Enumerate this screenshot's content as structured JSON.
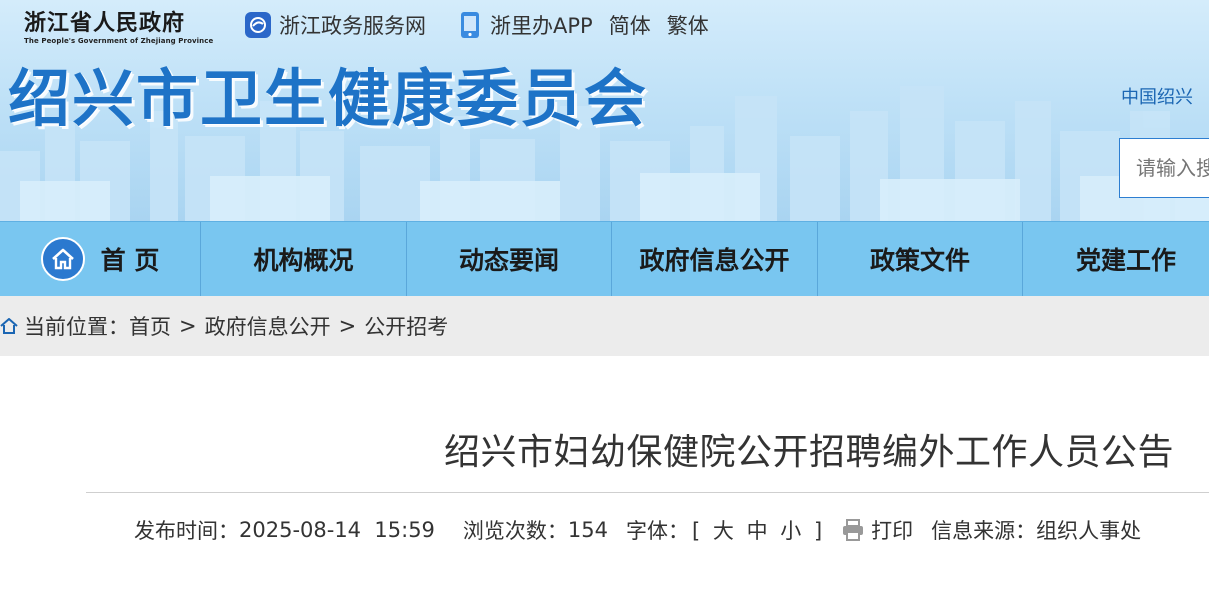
{
  "header": {
    "province_logo": {
      "zh": "浙江省人民政府",
      "en": "The People's Government of Zhejiang Province"
    },
    "links": {
      "gov_service": "浙江政务服务网",
      "app": "浙里办APP",
      "simplified": "简体",
      "traditional": "繁体"
    },
    "site_title": "绍兴市卫生健康委员会",
    "region_label": "中国绍兴",
    "search_placeholder": "请输入搜索内容"
  },
  "nav": {
    "items": [
      {
        "label": "首 页",
        "icon": "home-icon"
      },
      {
        "label": "机构概况"
      },
      {
        "label": "动态要闻"
      },
      {
        "label": "政府信息公开"
      },
      {
        "label": "政策文件"
      },
      {
        "label": "党建工作"
      }
    ]
  },
  "breadcrumb": {
    "prefix": "当前位置：",
    "items": [
      "首页",
      "政府信息公开",
      "公开招考"
    ],
    "separator": ">"
  },
  "article": {
    "title": "绍兴市妇幼保健院公开招聘编外工作人员公告",
    "meta": {
      "publish_label": "发布时间：",
      "publish_time": "2025-08-14  15:59",
      "views_label": "浏览次数：",
      "views": "154",
      "font_label": "字体：",
      "font_open": "[",
      "font_large": "大",
      "font_medium": "中",
      "font_small": "小",
      "font_close": "]",
      "print_label": "打印",
      "source_label": "信息来源：",
      "source": "组织人事处"
    }
  },
  "colors": {
    "title_blue": "#1e73c7",
    "nav_bg": "#79c6f0",
    "crumb_bg": "#ececec",
    "search_border": "#2d7ed1"
  }
}
